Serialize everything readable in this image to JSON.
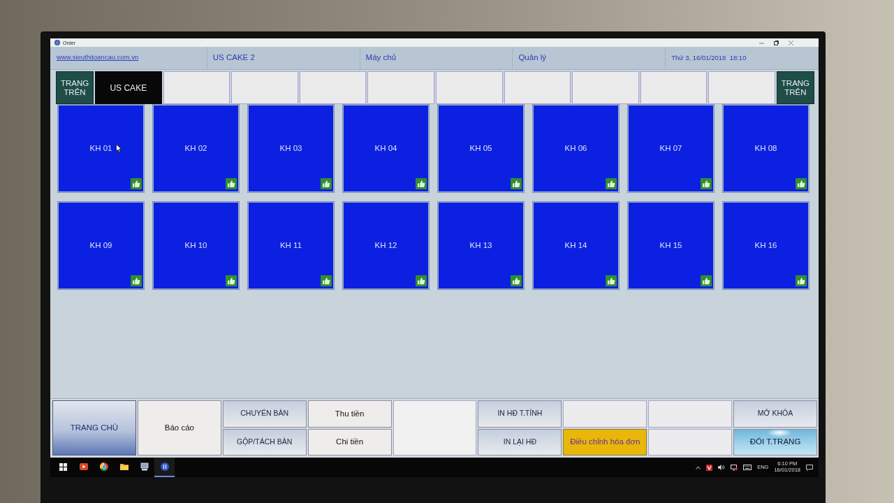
{
  "window": {
    "title": "Order"
  },
  "header": {
    "website": "www.sieuthitoancau.com.vn",
    "cells": [
      "US CAKE 2",
      "Máy chủ",
      "Quản lý",
      "Thứ 3, 16/01/2018  18:10"
    ]
  },
  "area_bar": {
    "previous_page": "TRANG TRÊN",
    "areas": [
      {
        "kind": "area",
        "label": "US CAKE",
        "selected": true
      },
      {
        "kind": "empty",
        "selected": false
      },
      {
        "kind": "empty",
        "selected": false
      },
      {
        "kind": "empty",
        "selected": false
      },
      {
        "kind": "empty",
        "selected": false
      },
      {
        "kind": "empty",
        "selected": false
      },
      {
        "kind": "empty",
        "selected": false
      },
      {
        "kind": "empty",
        "selected": false
      },
      {
        "kind": "empty",
        "selected": false
      },
      {
        "kind": "empty",
        "selected": false
      }
    ],
    "next_page": "TRANG TRÊN"
  },
  "tables": [
    {
      "label": "KH 01"
    },
    {
      "label": "KH 02"
    },
    {
      "label": "KH 03"
    },
    {
      "label": "KH 04"
    },
    {
      "label": "KH 05"
    },
    {
      "label": "KH 06"
    },
    {
      "label": "KH 07"
    },
    {
      "label": "KH 08"
    },
    {
      "label": "KH 09"
    },
    {
      "label": "KH 10"
    },
    {
      "label": "KH 11"
    },
    {
      "label": "KH 12"
    },
    {
      "label": "KH 13"
    },
    {
      "label": "KH 14"
    },
    {
      "label": "KH 15"
    },
    {
      "label": "KH 16"
    }
  ],
  "actions": [
    [
      {
        "kind": "primary",
        "label": "TRANG CHỦ"
      }
    ],
    [
      {
        "kind": "plain",
        "label": "Báo cáo"
      }
    ],
    [
      {
        "kind": "steel",
        "label": "CHUYỂN BÀN"
      },
      {
        "kind": "steel",
        "label": "GỘP/TÁCH BÀN"
      }
    ],
    [
      {
        "kind": "plain",
        "label": "Thu tiền"
      },
      {
        "kind": "plain",
        "label": "Chi tiền"
      }
    ],
    [
      {
        "kind": "blank"
      }
    ],
    [
      {
        "kind": "steel",
        "label": "IN HĐ T.TÍNH"
      },
      {
        "kind": "steel",
        "label": "IN LẠI HĐ"
      }
    ],
    [
      {
        "kind": "blank"
      },
      {
        "kind": "highlight",
        "label": "Điều chỉnh hóa đơn"
      }
    ],
    [
      {
        "kind": "blank"
      },
      {
        "kind": "blank"
      }
    ],
    [
      {
        "kind": "steel",
        "label": "MỞ KHÓA"
      },
      {
        "kind": "sky",
        "label": "ĐỔI T.TRẠNG"
      }
    ]
  ],
  "taskbar": {
    "apps": [
      {
        "open": false
      },
      {
        "open": false
      },
      {
        "open": false
      },
      {
        "open": false
      },
      {
        "open": true
      }
    ],
    "language": "ENG",
    "time": "6:10 PM",
    "date": "16/01/2018"
  }
}
